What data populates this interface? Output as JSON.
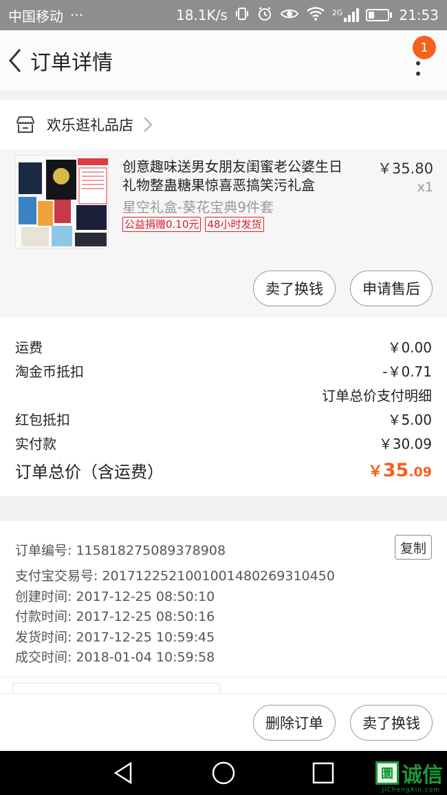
{
  "status_bar": {
    "carrier": "中国移动",
    "dots": "···",
    "speed": "18.1K/s",
    "net": "2G",
    "time": "21:53"
  },
  "header": {
    "title": "订单详情",
    "badge_count": "1"
  },
  "shop": {
    "name": "欢乐逛礼品店"
  },
  "item": {
    "title": "创意趣味送男女朋友闺蜜老公婆生日礼物整蛊糖果惊喜恶搞笑污礼盒",
    "sku": "星空礼盒-葵花宝典9件套",
    "tags": [
      "公益捐赠0.10元",
      "48小时发货"
    ],
    "price": "￥35.80",
    "qty": "x1",
    "thumb_label": "葵花宝典9件套",
    "buttons": [
      "卖了换钱",
      "申请售后"
    ]
  },
  "fees": {
    "shipping_label": "运费",
    "shipping_value": "￥0.00",
    "coins_label": "淘金币抵扣",
    "coins_value": "-￥0.71",
    "detail_link": "订单总价支付明细",
    "redpacket_label": "红包抵扣",
    "redpacket_value": "￥5.00",
    "paid_label": "实付款",
    "paid_value": "￥30.09",
    "total_label": "订单总价（含运费）",
    "total_symbol": "￥",
    "total_int": "35",
    "total_dec": ".09"
  },
  "meta": {
    "order_no": "订单编号: 115818275089378908",
    "alipay_no": "支付宝交易号: 2017122521001001480269310450",
    "created": "创建时间: 2017-12-25 08:50:10",
    "paid": "付款时间: 2017-12-25 08:50:16",
    "shipped": "发货时间: 2017-12-25 10:59:45",
    "closed": "成交时间: 2018-01-04 10:59:58",
    "copy_label": "复制"
  },
  "bottom": {
    "delete_label": "删除订单",
    "sell_label": "卖了换钱"
  },
  "watermark": {
    "mark": "圜",
    "text": "诚信",
    "sub": "JiChengXin.com"
  },
  "colors": {
    "accent": "#f5611a",
    "tag_red": "#d7202a",
    "status_bar": "#8e8e8e"
  }
}
